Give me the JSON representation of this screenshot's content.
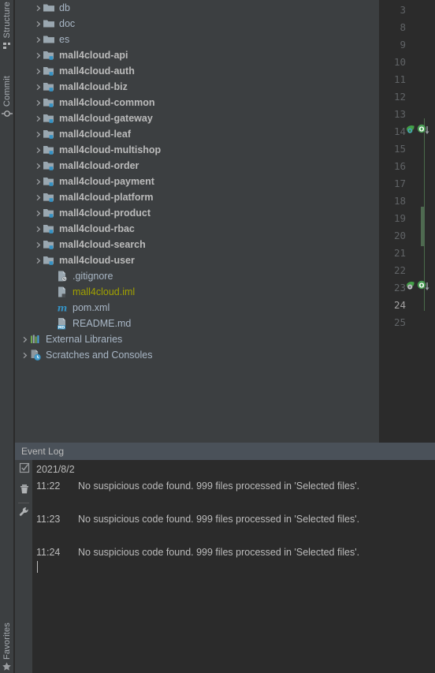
{
  "window": {
    "theme": "darcula",
    "bg_tree": "#3c3f41",
    "bg_editor": "#2b2b2b",
    "accent": "#4a5159",
    "text": "#a9b7c6"
  },
  "left_tool_strip": {
    "tabs": [
      {
        "label": "Structure",
        "icon": "structure-icon",
        "position": "top"
      },
      {
        "label": "Commit",
        "icon": "commit-icon",
        "position": "top"
      },
      {
        "label": "Favorites",
        "icon": "favorites-icon",
        "position": "bottom"
      }
    ]
  },
  "project_tree": {
    "rows": [
      {
        "label": "db",
        "indent": 1,
        "arrow": true,
        "icon": "folder-icon",
        "bold": false,
        "color": "default"
      },
      {
        "label": "doc",
        "indent": 1,
        "arrow": true,
        "icon": "folder-icon",
        "bold": false,
        "color": "default"
      },
      {
        "label": "es",
        "indent": 1,
        "arrow": true,
        "icon": "folder-icon",
        "bold": false,
        "color": "default"
      },
      {
        "label": "mall4cloud-api",
        "indent": 1,
        "arrow": true,
        "icon": "module-folder-icon",
        "bold": true,
        "color": "default"
      },
      {
        "label": "mall4cloud-auth",
        "indent": 1,
        "arrow": true,
        "icon": "module-folder-icon",
        "bold": true,
        "color": "default"
      },
      {
        "label": "mall4cloud-biz",
        "indent": 1,
        "arrow": true,
        "icon": "module-folder-icon",
        "bold": true,
        "color": "default"
      },
      {
        "label": "mall4cloud-common",
        "indent": 1,
        "arrow": true,
        "icon": "module-folder-icon",
        "bold": true,
        "color": "default"
      },
      {
        "label": "mall4cloud-gateway",
        "indent": 1,
        "arrow": true,
        "icon": "module-folder-icon",
        "bold": true,
        "color": "default"
      },
      {
        "label": "mall4cloud-leaf",
        "indent": 1,
        "arrow": true,
        "icon": "module-folder-icon",
        "bold": true,
        "color": "default"
      },
      {
        "label": "mall4cloud-multishop",
        "indent": 1,
        "arrow": true,
        "icon": "module-folder-icon",
        "bold": true,
        "color": "default"
      },
      {
        "label": "mall4cloud-order",
        "indent": 1,
        "arrow": true,
        "icon": "module-folder-icon",
        "bold": true,
        "color": "default"
      },
      {
        "label": "mall4cloud-payment",
        "indent": 1,
        "arrow": true,
        "icon": "module-folder-icon",
        "bold": true,
        "color": "default"
      },
      {
        "label": "mall4cloud-platform",
        "indent": 1,
        "arrow": true,
        "icon": "module-folder-icon",
        "bold": true,
        "color": "default"
      },
      {
        "label": "mall4cloud-product",
        "indent": 1,
        "arrow": true,
        "icon": "module-folder-icon",
        "bold": true,
        "color": "default"
      },
      {
        "label": "mall4cloud-rbac",
        "indent": 1,
        "arrow": true,
        "icon": "module-folder-icon",
        "bold": true,
        "color": "default"
      },
      {
        "label": "mall4cloud-search",
        "indent": 1,
        "arrow": true,
        "icon": "module-folder-icon",
        "bold": true,
        "color": "default"
      },
      {
        "label": "mall4cloud-user",
        "indent": 1,
        "arrow": true,
        "icon": "module-folder-icon",
        "bold": true,
        "color": "default"
      },
      {
        "label": ".gitignore",
        "indent": 2,
        "arrow": false,
        "icon": "gitignore-file-icon",
        "bold": false,
        "color": "default"
      },
      {
        "label": "mall4cloud.iml",
        "indent": 2,
        "arrow": false,
        "icon": "iml-file-icon",
        "bold": false,
        "color": "iml"
      },
      {
        "label": "pom.xml",
        "indent": 2,
        "arrow": false,
        "icon": "maven-file-icon",
        "bold": false,
        "color": "default"
      },
      {
        "label": "README.md",
        "indent": 2,
        "arrow": false,
        "icon": "markdown-file-icon",
        "bold": false,
        "color": "default"
      },
      {
        "label": "External Libraries",
        "indent": 0,
        "arrow": true,
        "icon": "libraries-icon",
        "bold": false,
        "color": "default"
      },
      {
        "label": "Scratches and Consoles",
        "indent": 0,
        "arrow": true,
        "icon": "scratches-icon",
        "bold": false,
        "color": "default"
      }
    ]
  },
  "editor": {
    "line_numbers": [
      "3",
      "8",
      "9",
      "10",
      "11",
      "12",
      "13",
      "14",
      "15",
      "16",
      "17",
      "18",
      "19",
      "20",
      "21",
      "22",
      "23",
      "24",
      "25"
    ],
    "current_line": "24",
    "gutter_markers": [
      {
        "line": "14",
        "icons": [
          "spring-bean-icon",
          "override-method-icon"
        ]
      },
      {
        "line": "23",
        "icons": [
          "spring-bean-icon",
          "override-method-icon"
        ]
      }
    ],
    "vcs_change_color": "#4e6a50"
  },
  "event_log": {
    "title": "Event Log",
    "toolbar": [
      {
        "name": "mark-all-read-button",
        "icon": "checkbox-icon"
      },
      {
        "name": "clear-all-button",
        "icon": "trash-icon"
      },
      {
        "name": "settings-button",
        "icon": "wrench-icon"
      }
    ],
    "date_header": "2021/8/2",
    "entries": [
      {
        "time": "11:22",
        "message": "No suspicious code found. 999 files processed in 'Selected files'."
      },
      {
        "time": "11:23",
        "message": "No suspicious code found. 999 files processed in 'Selected files'."
      },
      {
        "time": "11:24",
        "message": "No suspicious code found. 999 files processed in 'Selected files'."
      }
    ]
  }
}
